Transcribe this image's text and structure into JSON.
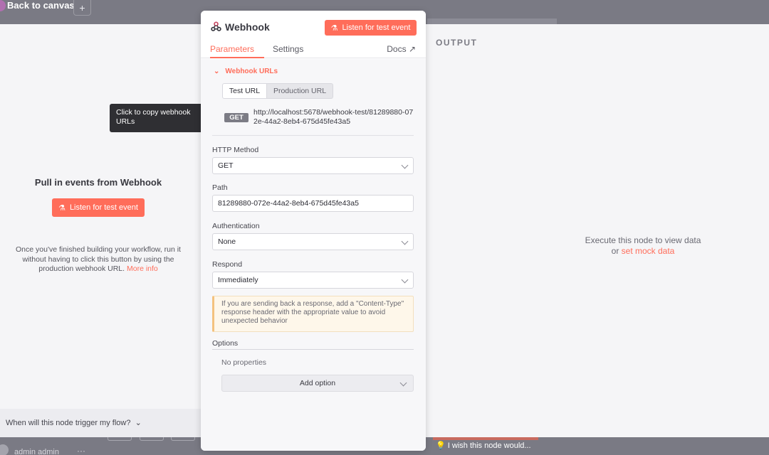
{
  "topbar": {
    "back_label": "Back to canvas",
    "plus_label": "+"
  },
  "left_panel": {
    "title": "Pull in events from Webhook",
    "listen_label": "Listen for test event",
    "info_text": "Once you've finished building your workflow, run it without having to click this button by using the production webhook URL.",
    "more_info_label": "More info",
    "trigger_question": "When will this node trigger my flow?"
  },
  "tooltip": {
    "text": "Click to copy webhook URLs"
  },
  "modal": {
    "title": "Webhook",
    "listen_label": "Listen for test event",
    "tabs": {
      "parameters": "Parameters",
      "settings": "Settings",
      "docs": "Docs"
    },
    "webhook_urls": {
      "section_label": "Webhook URLs",
      "test_url_label": "Test URL",
      "production_url_label": "Production URL",
      "method_badge": "GET",
      "url": "http://localhost:5678/webhook-test/81289880-072e-44a2-8eb4-675d45fe43a5"
    },
    "http_method": {
      "label": "HTTP Method",
      "value": "GET"
    },
    "path": {
      "label": "Path",
      "value": "81289880-072e-44a2-8eb4-675d45fe43a5"
    },
    "authentication": {
      "label": "Authentication",
      "value": "None"
    },
    "respond": {
      "label": "Respond",
      "value": "Immediately"
    },
    "notice": "If you are sending back a response, add a \"Content-Type\" response header with the appropriate value to avoid unexpected behavior",
    "options": {
      "label": "Options",
      "empty_text": "No properties",
      "add_label": "Add option"
    }
  },
  "right_panel": {
    "output_label": "OUTPUT",
    "execute_text": "Execute this node to view data",
    "or_text": "or",
    "mock_link": "set mock data"
  },
  "bottombar": {
    "user": "admin admin",
    "dots": "···",
    "wish": "I wish this node would..."
  },
  "colors": {
    "accent": "#ff6d5a",
    "backdrop": "#7a7a84",
    "notice_border": "#f4c27e"
  }
}
